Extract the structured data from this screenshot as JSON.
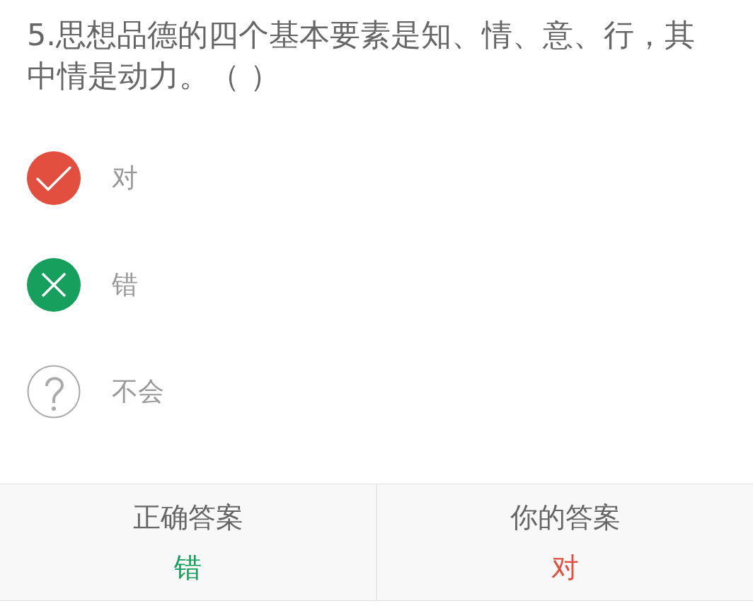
{
  "question": "5.思想品德的四个基本要素是知、情、意、行，其中情是动力。（  ）",
  "options": [
    {
      "label": "对",
      "kind": "true",
      "selected": true,
      "correct": false
    },
    {
      "label": "错",
      "kind": "false",
      "selected": false,
      "correct": true
    },
    {
      "label": "不会",
      "kind": "unsure",
      "selected": false,
      "correct": false
    }
  ],
  "summary": [
    {
      "label": "正确答案",
      "answer": "错",
      "color": "#17a05d"
    },
    {
      "label": "你的答案",
      "answer": "对",
      "color": "#e24f3f"
    }
  ]
}
